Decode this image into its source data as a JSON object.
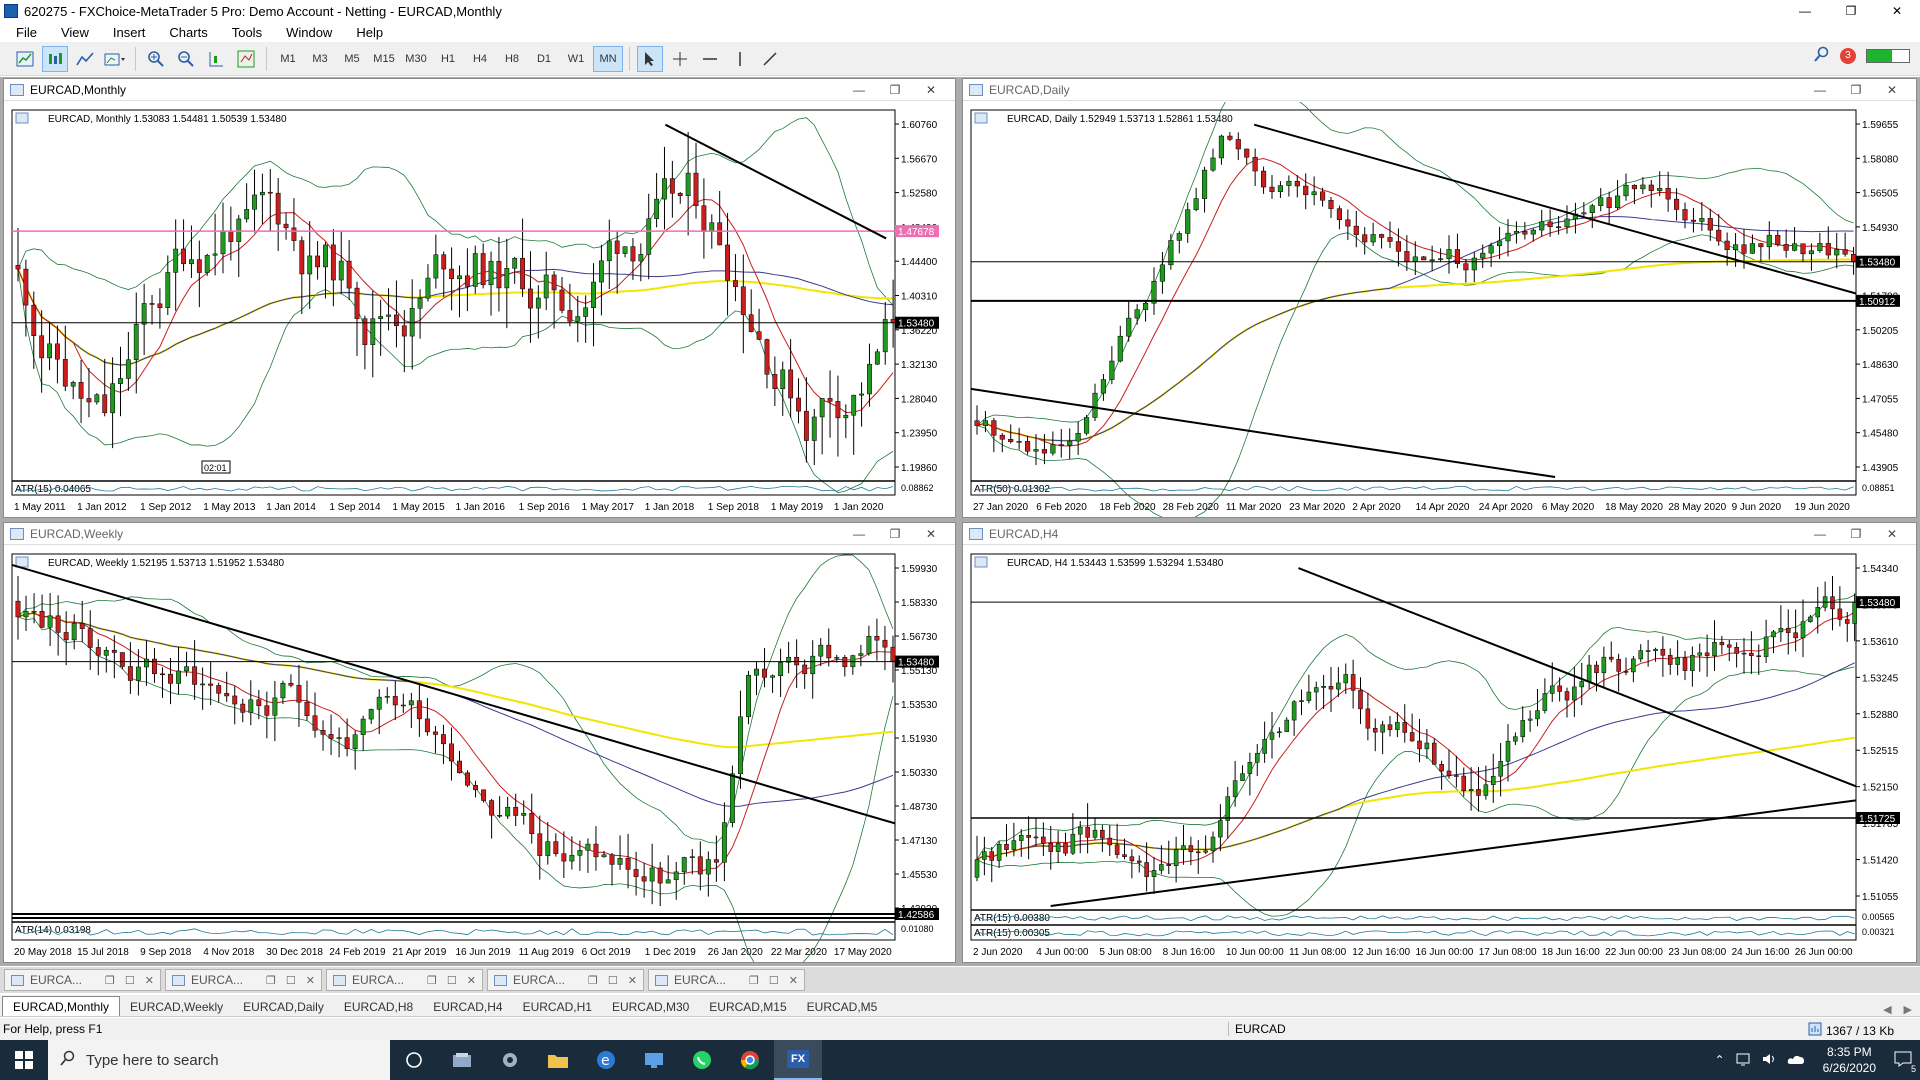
{
  "window": {
    "title": "620275 - FXChoice-MetaTrader 5 Pro: Demo Account - Netting - EURCAD,Monthly",
    "controls": [
      "—",
      "❐",
      "✕"
    ]
  },
  "menu": [
    "File",
    "View",
    "Insert",
    "Charts",
    "Tools",
    "Window",
    "Help"
  ],
  "toolbar": {
    "icons": [
      "new-chart-icon",
      "chart-profiles-icon",
      "indicators-icon",
      "templates-icon",
      "zoom-in-icon",
      "zoom-out-icon",
      "chart-shift-icon",
      "autoscroll-icon"
    ],
    "timeframes": [
      "M1",
      "M3",
      "M5",
      "M15",
      "M30",
      "H1",
      "H4",
      "H8",
      "D1",
      "W1",
      "MN"
    ],
    "active_timeframe": "MN",
    "tools": [
      "cursor-icon",
      "crosshair-icon",
      "horizontal-line-icon",
      "vertical-line-icon",
      "trendline-icon"
    ],
    "notification_count": "3"
  },
  "charts": [
    {
      "id": "monthly",
      "window_title": "EURCAD,Monthly",
      "active": true,
      "info": "EURCAD, Monthly 1.53083 1.54481 1.50539 1.53480",
      "price_ticks": [
        "1.60760",
        "1.56670",
        "1.52580",
        "1.48490",
        "1.44400",
        "1.40310",
        "1.36220",
        "1.32130",
        "1.28040",
        "1.23950",
        "1.19860"
      ],
      "price_label": "1.53480",
      "price_label_color": "#000000",
      "extra_label": "1.47678",
      "extra_label_color": "#f06db5",
      "indicator": "ATR(15) 0.04065",
      "indicator_tick": "0.08862",
      "time_ticks": [
        "1 May 2011",
        "1 Jan 2012",
        "1 Sep 2012",
        "1 May 2013",
        "1 Jan 2014",
        "1 Sep 2014",
        "1 May 2015",
        "1 Jan 2016",
        "1 Sep 2016",
        "1 May 2017",
        "1 Jan 2018",
        "1 Sep 2018",
        "1 May 2019",
        "1 Jan 2020"
      ],
      "countdown": "02:01"
    },
    {
      "id": "daily",
      "window_title": "EURCAD,Daily",
      "active": false,
      "info": "EURCAD, Daily 1.52949 1.53713 1.52861 1.53480",
      "price_ticks": [
        "1.59655",
        "1.58080",
        "1.56505",
        "1.54930",
        "1.53355",
        "1.51780",
        "1.50205",
        "1.48630",
        "1.47055",
        "1.45480",
        "1.43905"
      ],
      "price_label": "1.53480",
      "price_label_color": "#000000",
      "extra_label": "1.50912",
      "extra_label_color": "#000000",
      "indicator": "ATR(50) 0.01302",
      "indicator_tick": "0.08851",
      "time_ticks": [
        "27 Jan 2020",
        "6 Feb 2020",
        "18 Feb 2020",
        "28 Feb 2020",
        "11 Mar 2020",
        "23 Mar 2020",
        "2 Apr 2020",
        "14 Apr 2020",
        "24 Apr 2020",
        "6 May 2020",
        "18 May 2020",
        "28 May 2020",
        "9 Jun 2020",
        "19 Jun 2020"
      ]
    },
    {
      "id": "weekly",
      "window_title": "EURCAD,Weekly",
      "active": false,
      "info": "EURCAD, Weekly 1.52195 1.53713 1.51952 1.53480",
      "price_ticks": [
        "1.59930",
        "1.58330",
        "1.56730",
        "1.55130",
        "1.53530",
        "1.51930",
        "1.50330",
        "1.48730",
        "1.47130",
        "1.45530",
        "1.43930"
      ],
      "price_label": "1.53480",
      "price_label_color": "#000000",
      "extra_label": "1.42586",
      "extra_label_color": "#000000",
      "indicator": "ATR(14) 0.03198",
      "indicator_tick": "0.01080",
      "time_ticks": [
        "20 May 2018",
        "15 Jul 2018",
        "9 Sep 2018",
        "4 Nov 2018",
        "30 Dec 2018",
        "24 Feb 2019",
        "21 Apr 2019",
        "16 Jun 2019",
        "11 Aug 2019",
        "6 Oct 2019",
        "1 Dec 2019",
        "26 Jan 2020",
        "22 Mar 2020",
        "17 May 2020"
      ]
    },
    {
      "id": "h4",
      "window_title": "EURCAD,H4",
      "active": false,
      "info": "EURCAD, H4 1.53443 1.53599 1.53294 1.53480",
      "price_ticks": [
        "1.54340",
        "1.53975",
        "1.53610",
        "1.53245",
        "1.52880",
        "1.52515",
        "1.52150",
        "1.51785",
        "1.51420",
        "1.51055"
      ],
      "price_label": "1.53480",
      "price_label_color": "#000000",
      "extra_label": "1.51725",
      "extra_label_color": "#000000",
      "indicator": "ATR(15) 0.00380",
      "indicator_tick": "0.00565",
      "indicator2": "ATR(15) 0.00305",
      "indicator2_tick": "0.00321",
      "time_ticks": [
        "2 Jun 2020",
        "4 Jun 00:00",
        "5 Jun 08:00",
        "8 Jun 16:00",
        "10 Jun 00:00",
        "11 Jun 08:00",
        "12 Jun 16:00",
        "16 Jun 00:00",
        "17 Jun 08:00",
        "18 Jun 16:00",
        "22 Jun 00:00",
        "23 Jun 08:00",
        "24 Jun 16:00",
        "26 Jun 00:00"
      ]
    }
  ],
  "window_tabs": [
    "EURCA...",
    "EURCA...",
    "EURCA...",
    "EURCA...",
    "EURCA..."
  ],
  "chart_tabs": [
    "EURCAD,Monthly",
    "EURCAD,Weekly",
    "EURCAD,Daily",
    "EURCAD,H8",
    "EURCAD,H4",
    "EURCAD,H1",
    "EURCAD,M30",
    "EURCAD,M15",
    "EURCAD,M5"
  ],
  "active_chart_tab": "EURCAD,Monthly",
  "status": {
    "help": "For Help, press F1",
    "symbol": "EURCAD",
    "traffic": "1367 / 13 Kb"
  },
  "taskbar": {
    "search_placeholder": "Type here to search",
    "apps": [
      "task-view-icon",
      "explorer-alt-icon",
      "settings-alt-icon",
      "file-explorer-icon",
      "edge-icon",
      "remote-icon",
      "whatsapp-icon",
      "chrome-icon",
      "fxchoice-icon"
    ],
    "active_app_label": "FX",
    "time": "8:35 PM",
    "date": "6/26/2020",
    "notifications": "5"
  },
  "colors": {
    "bull": "#1f9a1f",
    "bear": "#c81e1e",
    "ma_fast": "#c81e1e",
    "ma_slow": "#3a3a8c",
    "ma_long": "#f2e600",
    "bands": "#1e7a3a",
    "pink_line": "#f06db5"
  }
}
